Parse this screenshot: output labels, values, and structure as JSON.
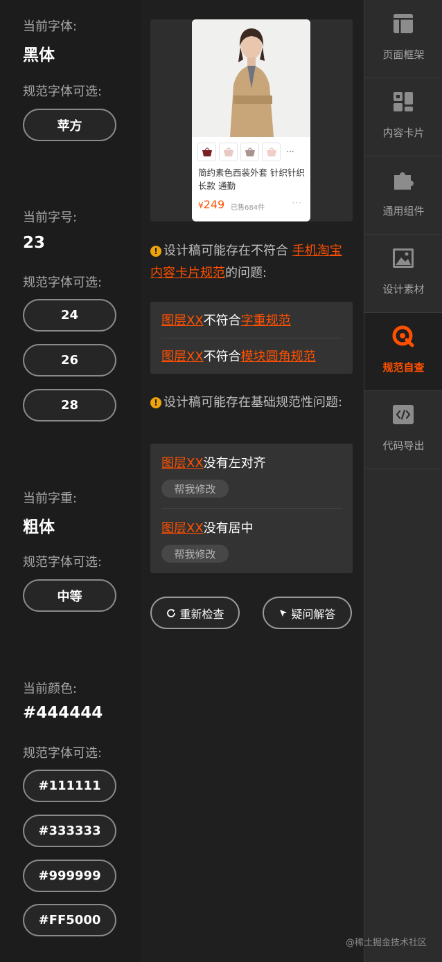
{
  "left": {
    "font": {
      "label": "当前字体:",
      "value": "黑体",
      "options_label": "规范字体可选:",
      "options": [
        "苹方"
      ]
    },
    "size": {
      "label": "当前字号:",
      "value": "23",
      "options_label": "规范字体可选:",
      "options": [
        "24",
        "26",
        "28"
      ]
    },
    "weight": {
      "label": "当前字重:",
      "value": "粗体",
      "options_label": "规范字体可选:",
      "options": [
        "中等"
      ]
    },
    "color": {
      "label": "当前颜色:",
      "value": "#444444",
      "options_label": "规范字体可选:",
      "options": [
        "#111111",
        "#333333",
        "#999999",
        "#FF5000"
      ]
    }
  },
  "card": {
    "title": "简约素色西装外套 针织针织长款 通勤",
    "currency": "¥",
    "price": "249",
    "sold": "已售684件",
    "more": "···",
    "thumb_more": "···"
  },
  "warnings": {
    "first_prefix": "设计稿可能存在不符合 ",
    "first_link": "手机淘宝内容卡片规范",
    "first_suffix": "的问题:",
    "second": "设计稿可能存在基础规范性问题:"
  },
  "issues_a": [
    {
      "layer": "图层XX",
      "mid": "不符合",
      "rule": "字重规范"
    },
    {
      "layer": "图层XX",
      "mid": "不符合",
      "rule": "模块圆角规范"
    }
  ],
  "issues_b": [
    {
      "layer": "图层XX",
      "text": "没有左对齐",
      "fix": "帮我修改"
    },
    {
      "layer": "图层XX",
      "text": "没有居中",
      "fix": "帮我修改"
    }
  ],
  "actions": {
    "recheck": "重新检查",
    "faq": "疑问解答"
  },
  "nav": [
    {
      "icon": "page-frame-icon",
      "label": "页面框架"
    },
    {
      "icon": "content-card-icon",
      "label": "内容卡片"
    },
    {
      "icon": "component-icon",
      "label": "通用组件"
    },
    {
      "icon": "image-asset-icon",
      "label": "设计素材"
    },
    {
      "icon": "spec-check-icon",
      "label": "规范自查"
    },
    {
      "icon": "code-export-icon",
      "label": "代码导出"
    }
  ],
  "colors": {
    "accent": "#ff5000",
    "warning": "#f0a30a"
  },
  "watermark": "@稀土掘金技术社区"
}
